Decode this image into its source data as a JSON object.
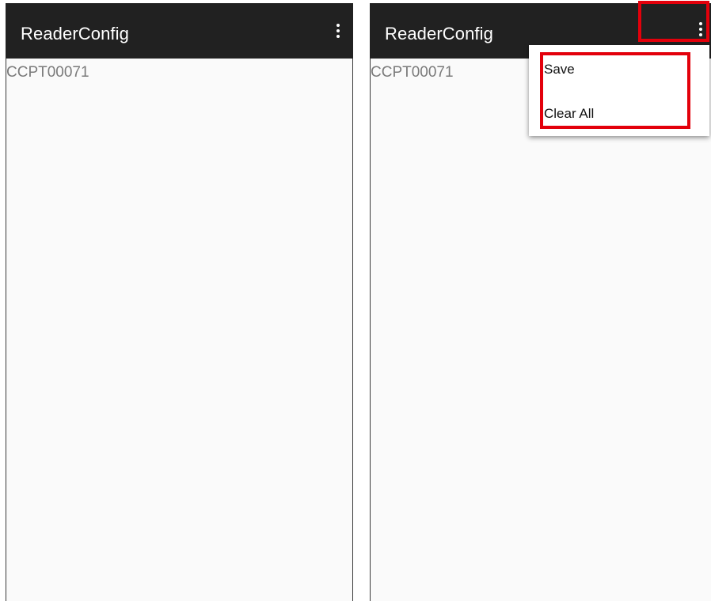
{
  "screens": [
    {
      "app_title": "ReaderConfig",
      "device_id": "CCPT00071",
      "overflow_icon": "more-vert-icon"
    },
    {
      "app_title": "ReaderConfig",
      "device_id": "CCPT00071",
      "overflow_icon": "more-vert-icon",
      "menu": {
        "items": [
          "Save",
          "Clear All"
        ]
      }
    }
  ],
  "colors": {
    "appbar": "#212121",
    "highlight": "#e3000b",
    "background": "#fafafa"
  }
}
